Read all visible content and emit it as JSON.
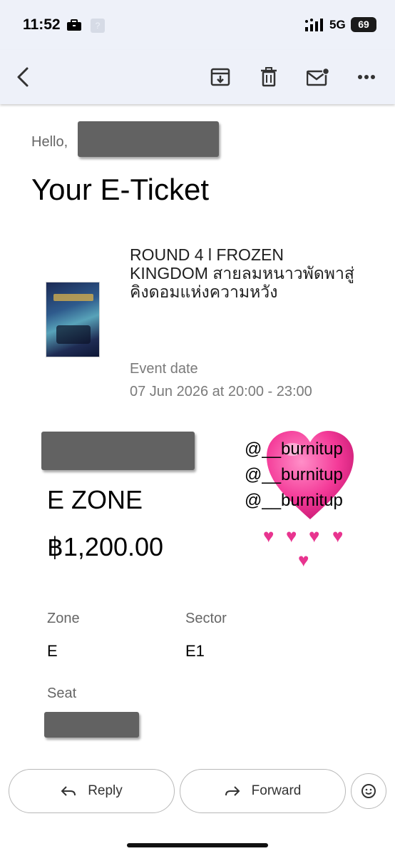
{
  "status_bar": {
    "time": "11:52",
    "network": "5G",
    "battery": "69"
  },
  "icons": {
    "back": "arrow-back-icon",
    "archive": "archive-icon",
    "delete": "trash-icon",
    "mark_unread": "mail-unread-icon",
    "more": "more-horizontal-icon",
    "reply": "reply-arrow-icon",
    "forward": "forward-arrow-icon",
    "emoji": "emoji-smile-icon"
  },
  "email": {
    "greeting": "Hello,",
    "title": "Your E-Ticket",
    "event_name": "ROUND 4 l FROZEN KINGDOM สายลมหนาวพัดพาสู่คิงดอมแห่งความหวัง",
    "event_date_label": "Event date",
    "event_date": "07 Jun 2026 at 20:00 - 23:00",
    "zone_heading": "E ZONE",
    "price": "฿1,200.00",
    "zone_label": "Zone",
    "zone_value": "E",
    "sector_label": "Sector",
    "sector_value": "E1",
    "seat_label": "Seat"
  },
  "watermark": {
    "lines": [
      "@__burnitup",
      "@__burnitup",
      "@__burnitup"
    ],
    "heart_color": "#e8348f"
  },
  "actions": {
    "reply": "Reply",
    "forward": "Forward"
  },
  "colors": {
    "bar_bg": "#eef1f9",
    "redaction": "#626262"
  }
}
